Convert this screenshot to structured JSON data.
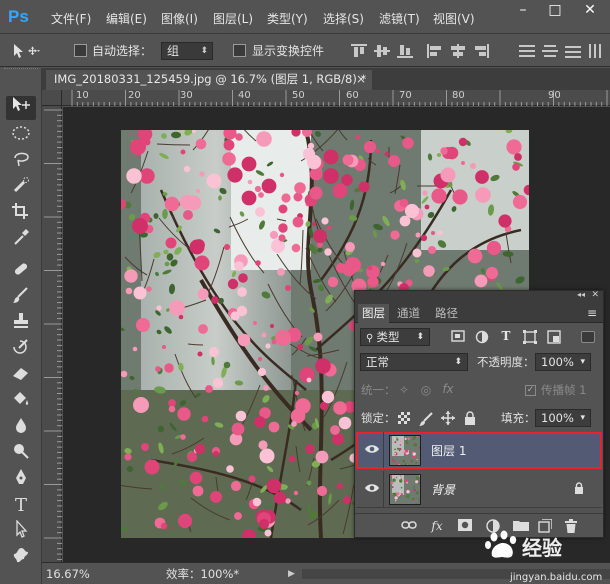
{
  "app": {
    "logo": "Ps"
  },
  "menu": [
    "文件(F)",
    "编辑(E)",
    "图像(I)",
    "图层(L)",
    "类型(Y)",
    "选择(S)",
    "滤镜(T)",
    "视图(V)"
  ],
  "window_controls": {
    "minimize": "–",
    "maximize": "□",
    "close": "✕"
  },
  "options": {
    "auto_select_label": "自动选择：",
    "auto_select_value": "组",
    "show_transform_label": "显示变换控件"
  },
  "document": {
    "tab_title": "IMG_20180331_125459.jpg @ 16.7% (图层 1, RGB/8) *",
    "close": "×"
  },
  "ruler": {
    "top_ticks": [
      "10",
      "20",
      "30",
      "40",
      "50",
      "60",
      "70",
      "80",
      "90"
    ],
    "left_ticks": [
      "0",
      "1",
      "2",
      "3",
      "4",
      "5",
      "6",
      "7",
      "8",
      "9",
      "1",
      "1",
      "1",
      "1",
      "1",
      "1",
      "1",
      "1",
      "1",
      "1",
      "1",
      "1",
      "1",
      "1",
      "1"
    ]
  },
  "status": {
    "zoom": "16.67%",
    "efficiency": "效率：100%*",
    "arrow": "▶"
  },
  "layers_panel": {
    "collapse": "◂◂",
    "close": "✕",
    "tabs": [
      "图层",
      "通道",
      "路径"
    ],
    "menu_icon": "≡",
    "filter_kind": "类型",
    "blend_mode": "正常",
    "opacity_label": "不透明度：",
    "opacity_value": "100%",
    "unify_label": "统一：",
    "propagate_label": "传播帧 1",
    "lock_label": "锁定：",
    "fill_label": "填充：",
    "fill_value": "100%",
    "layers": [
      {
        "name": "图层 1",
        "selected": true,
        "locked": false
      },
      {
        "name": "背景",
        "selected": false,
        "locked": true
      }
    ]
  },
  "watermark": {
    "text": "经验",
    "url": "jingyan.baidu.com"
  },
  "colors": {
    "bg": "#535353",
    "canvas_bg": "#282828",
    "selection_outline": "#e8242a",
    "selected_layer": "#535a74",
    "ps_blue": "#31a8ff"
  },
  "icons": [
    "move-tool",
    "marquee-tool",
    "lasso-tool",
    "quick-select-tool",
    "crop-tool",
    "eyedropper-tool",
    "healing-tool",
    "brush-tool",
    "stamp-tool",
    "history-brush-tool",
    "eraser-tool",
    "paint-bucket-tool",
    "blur-tool",
    "dodge-tool",
    "pen-tool",
    "type-tool",
    "path-select-tool",
    "shape-tool"
  ]
}
